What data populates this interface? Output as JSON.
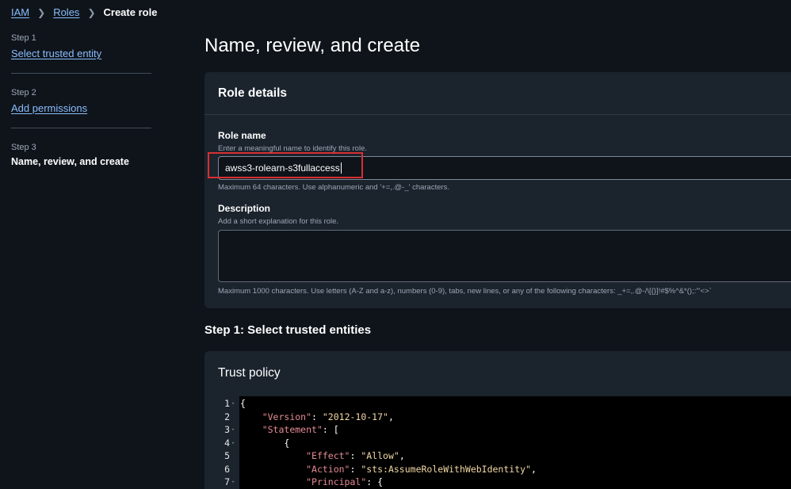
{
  "breadcrumb": {
    "items": [
      "IAM",
      "Roles"
    ],
    "current": "Create role"
  },
  "steps": [
    {
      "num": "Step 1",
      "label": "Select trusted entity"
    },
    {
      "num": "Step 2",
      "label": "Add permissions"
    },
    {
      "num": "Step 3",
      "label": "Name, review, and create"
    }
  ],
  "page": {
    "title": "Name, review, and create"
  },
  "role_details": {
    "header": "Role details",
    "role_name_label": "Role name",
    "role_name_hint": "Enter a meaningful name to identify this role.",
    "role_name_value": "awss3-rolearn-s3fullaccess",
    "role_name_constraint": "Maximum 64 characters. Use alphanumeric and '+=,.@-_' characters.",
    "description_label": "Description",
    "description_hint": "Add a short explanation for this role.",
    "description_value": "",
    "description_constraint": "Maximum 1000 characters. Use letters (A-Z and a-z), numbers (0-9), tabs, new lines, or any of the following characters: _+=,.@-/\\[{}]!#$%^&*();:\"'<>`"
  },
  "section1": {
    "title": "Step 1: Select trusted entities"
  },
  "trust_policy": {
    "header": "Trust policy",
    "lines": [
      {
        "n": "1",
        "fold": true,
        "indent": "",
        "key": "",
        "sep": "",
        "val": "",
        "tail": "{"
      },
      {
        "n": "2",
        "fold": false,
        "indent": "    ",
        "key": "\"Version\"",
        "sep": ": ",
        "val": "\"2012-10-17\"",
        "tail": ","
      },
      {
        "n": "3",
        "fold": true,
        "indent": "    ",
        "key": "\"Statement\"",
        "sep": ": ",
        "val": "",
        "tail": "["
      },
      {
        "n": "4",
        "fold": true,
        "indent": "        ",
        "key": "",
        "sep": "",
        "val": "",
        "tail": "{"
      },
      {
        "n": "5",
        "fold": false,
        "indent": "            ",
        "key": "\"Effect\"",
        "sep": ": ",
        "val": "\"Allow\"",
        "tail": ","
      },
      {
        "n": "6",
        "fold": false,
        "indent": "            ",
        "key": "\"Action\"",
        "sep": ": ",
        "val": "\"sts:AssumeRoleWithWebIdentity\"",
        "tail": ","
      },
      {
        "n": "7",
        "fold": true,
        "indent": "            ",
        "key": "\"Principal\"",
        "sep": ": ",
        "val": "",
        "tail": "{"
      }
    ]
  },
  "colors": {
    "background": "#0f141a",
    "panel": "#1b232d",
    "link": "#89bdff",
    "highlight_border": "#d63031",
    "json_key": "#e58a94",
    "json_string": "#f3d9a4"
  }
}
